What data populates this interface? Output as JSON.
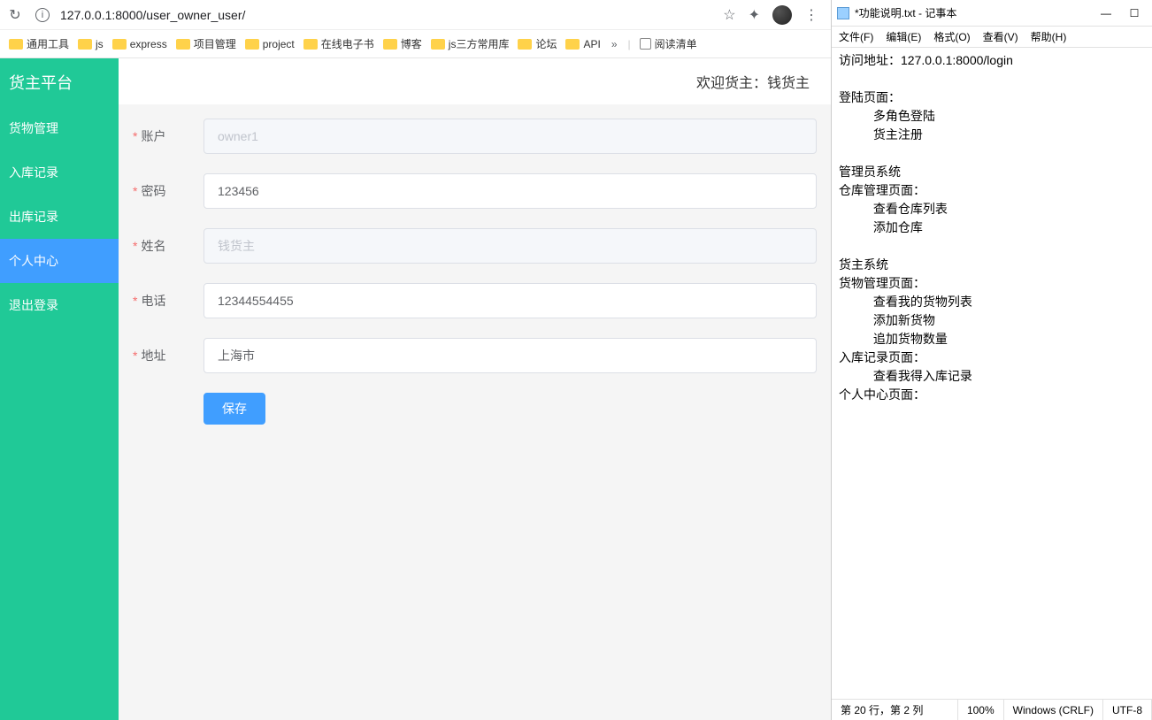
{
  "browser": {
    "url": "127.0.0.1:8000/user_owner_user/",
    "bookmarks": [
      "通用工具",
      "js",
      "express",
      "项目管理",
      "project",
      "在线电子书",
      "博客",
      "js三方常用库",
      "论坛",
      "API"
    ],
    "overflow": "»",
    "readlist_label": "阅读清单"
  },
  "app": {
    "brand": "货主平台",
    "nav": [
      "货物管理",
      "入库记录",
      "出库记录",
      "个人中心",
      "退出登录"
    ],
    "active_index": 3,
    "welcome": "欢迎货主：钱货主",
    "form": {
      "account": {
        "label": "账户",
        "value": "owner1"
      },
      "password": {
        "label": "密码",
        "value": "123456"
      },
      "name": {
        "label": "姓名",
        "value": "钱货主"
      },
      "phone": {
        "label": "电话",
        "value": "12344554455"
      },
      "address": {
        "label": "地址",
        "value": "上海市"
      },
      "save": "保存"
    }
  },
  "notepad": {
    "title": "*功能说明.txt - 记事本",
    "menus": [
      "文件(F)",
      "编辑(E)",
      "格式(O)",
      "查看(V)",
      "帮助(H)"
    ],
    "content": "访问地址：127.0.0.1:8000/login\n\n登陆页面：\n          多角色登陆\n          货主注册\n\n管理员系统\n仓库管理页面：\n          查看仓库列表\n          添加仓库\n\n货主系统\n货物管理页面：\n          查看我的货物列表\n          添加新货物\n          追加货物数量\n入库记录页面：\n          查看我得入库记录\n个人中心页面：\n",
    "status": {
      "pos": "第 20 行，第 2 列",
      "zoom": "100%",
      "eol": "Windows (CRLF)",
      "enc": "UTF-8"
    }
  }
}
